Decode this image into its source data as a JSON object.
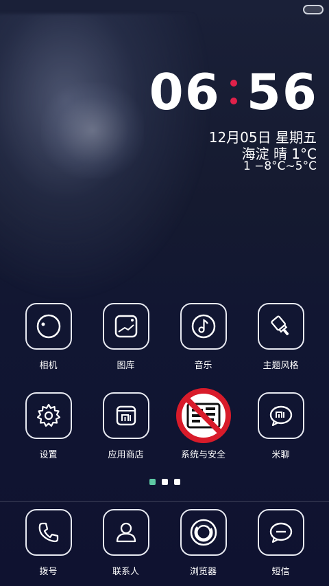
{
  "lockscreen": {
    "clock": {
      "hours": "06",
      "minutes": "56"
    },
    "date": "12月05日 星期五",
    "weather": "海淀 晴 1°C",
    "temperature_range": "1 −8°C~5°C"
  },
  "apps": {
    "row1": [
      {
        "label": "相机",
        "icon": "camera-icon"
      },
      {
        "label": "图库",
        "icon": "gallery-icon"
      },
      {
        "label": "音乐",
        "icon": "music-icon"
      },
      {
        "label": "主题风格",
        "icon": "theme-brush-icon"
      }
    ],
    "row2": [
      {
        "label": "设置",
        "icon": "gear-icon"
      },
      {
        "label": "应用商店",
        "icon": "mi-store-icon"
      },
      {
        "label": "系统与安全",
        "icon": "security-prohibited-icon"
      },
      {
        "label": "米聊",
        "icon": "mi-chat-icon"
      }
    ]
  },
  "page_indicator": {
    "count": 3,
    "active": 1
  },
  "dock": [
    {
      "label": "拨号",
      "icon": "phone-icon"
    },
    {
      "label": "联系人",
      "icon": "contacts-icon"
    },
    {
      "label": "浏览器",
      "icon": "browser-icon"
    },
    {
      "label": "短信",
      "icon": "message-icon"
    }
  ],
  "colors": {
    "clock_dot": "#e0214a",
    "active_page_dot": "#5ec9a4",
    "prohibit_red": "#d81b2a"
  }
}
